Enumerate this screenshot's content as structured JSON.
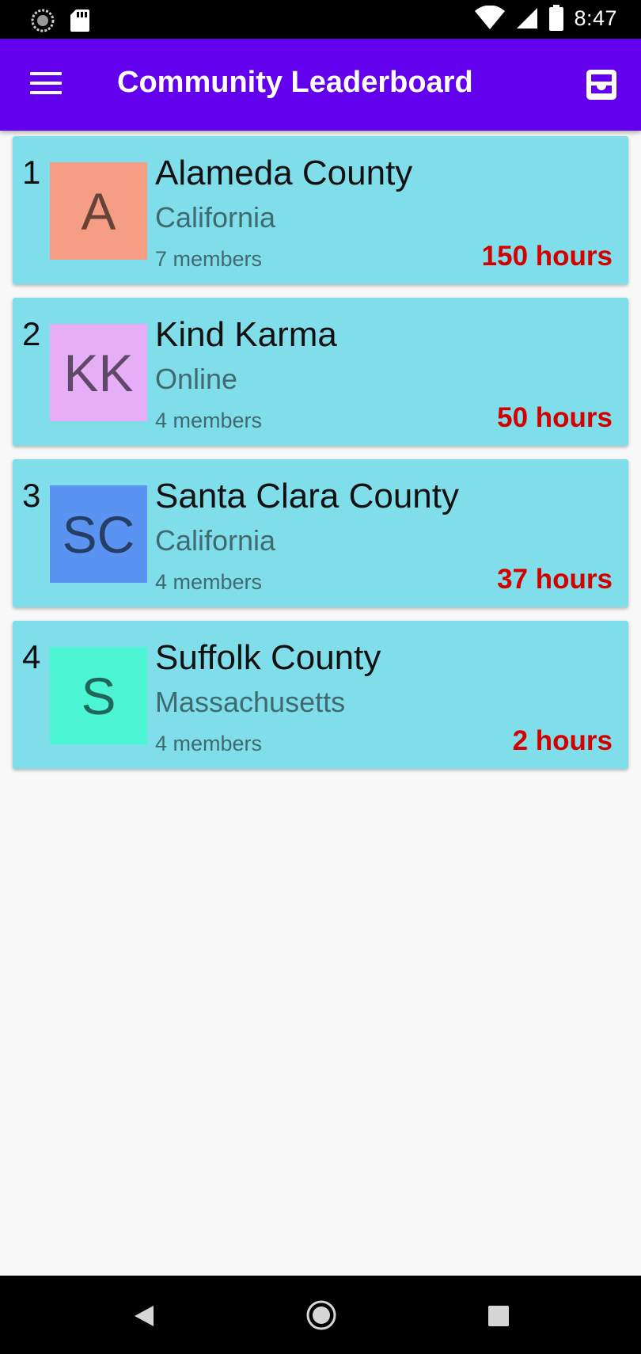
{
  "status_bar": {
    "time": "8:47",
    "icons": [
      "sync-icon",
      "sd-card-icon",
      "wifi-icon",
      "signal-icon",
      "battery-icon"
    ]
  },
  "app_bar": {
    "title": "Community Leaderboard",
    "menu_icon": "menu-icon",
    "action_icon": "inbox-icon",
    "background": "#6200ee"
  },
  "leaderboard": [
    {
      "rank": "1",
      "initials": "A",
      "name": "Alameda County",
      "region": "California",
      "members": "7 members",
      "hours": "150 hours",
      "avatar_color": "#f59e85"
    },
    {
      "rank": "2",
      "initials": "KK",
      "name": "Kind Karma",
      "region": "Online",
      "members": "4 members",
      "hours": "50 hours",
      "avatar_color": "#e5aef7"
    },
    {
      "rank": "3",
      "initials": "SC",
      "name": "Santa Clara County",
      "region": "California",
      "members": "4 members",
      "hours": "37 hours",
      "avatar_color": "#5b93f2"
    },
    {
      "rank": "4",
      "initials": "S",
      "name": "Suffolk County",
      "region": "Massachusetts",
      "members": "4 members",
      "hours": "2 hours",
      "avatar_color": "#4cf5d3"
    }
  ],
  "colors": {
    "card_background": "#80deea",
    "hours_text": "#d40000"
  },
  "nav_bar": {
    "icons": [
      "back-icon",
      "home-icon",
      "recents-icon"
    ]
  }
}
